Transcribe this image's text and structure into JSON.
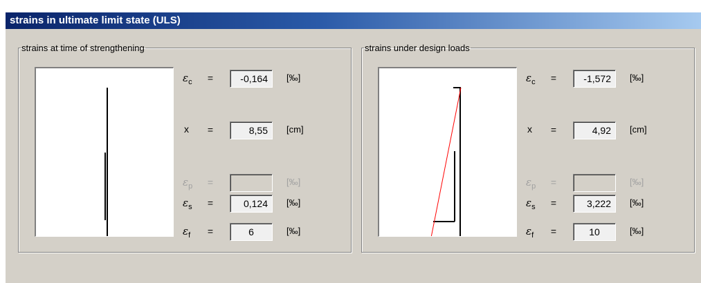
{
  "title": "strains in ultimate limit state (ULS)",
  "left_panel": {
    "legend": "strains at time of strengthening",
    "rows": [
      {
        "sym": "ε",
        "sub": "c",
        "eq": "=",
        "value": "-0,164",
        "unit": "[‰]"
      },
      {
        "sym": "x",
        "sub": "",
        "eq": "=",
        "value": "8,55",
        "unit": "[cm]"
      },
      {
        "sym": "ε",
        "sub": "p",
        "eq": "=",
        "value": "",
        "unit": "[‰]"
      },
      {
        "sym": "ε",
        "sub": "s",
        "eq": "=",
        "value": "0,124",
        "unit": "[‰]"
      },
      {
        "sym": "ε",
        "sub": "f",
        "eq": "=",
        "value": "6",
        "unit": "[‰]"
      }
    ]
  },
  "right_panel": {
    "legend": "strains under design loads",
    "rows": [
      {
        "sym": "ε",
        "sub": "c",
        "eq": "=",
        "value": "-1,572",
        "unit": "[‰]"
      },
      {
        "sym": "x",
        "sub": "",
        "eq": "=",
        "value": "4,92",
        "unit": "[cm]"
      },
      {
        "sym": "ε",
        "sub": "p",
        "eq": "=",
        "value": "",
        "unit": "[‰]"
      },
      {
        "sym": "ε",
        "sub": "s",
        "eq": "=",
        "value": "3,222",
        "unit": "[‰]"
      },
      {
        "sym": "ε",
        "sub": "f",
        "eq": "=",
        "value": "10",
        "unit": "[‰]"
      }
    ]
  },
  "colors": {
    "strain_line": "#000000",
    "fiber_line": "#0000cc",
    "resultant_line": "#ff0000"
  }
}
